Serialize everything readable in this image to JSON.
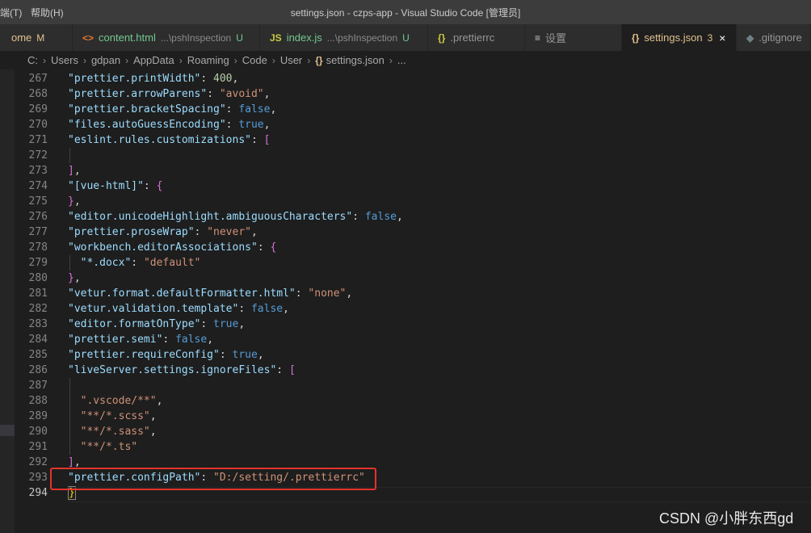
{
  "titlebar": {
    "menu_items": [
      "端(T)",
      "帮助(H)"
    ],
    "title": "settings.json - czps-app - Visual Studio Code [管理员]"
  },
  "tabs": [
    {
      "icon": "",
      "name": "ome",
      "desc": "",
      "status": "M",
      "active": false
    },
    {
      "icon": "<>",
      "name": "content.html",
      "desc": "...\\pshInspection",
      "status": "U",
      "active": false
    },
    {
      "icon": "JS",
      "name": "index.js",
      "desc": "...\\pshInspection",
      "status": "U",
      "active": false
    },
    {
      "icon": "{}",
      "name": ".prettierrc",
      "desc": "",
      "status": "",
      "active": false
    },
    {
      "icon": "≡",
      "name": "设置",
      "desc": "",
      "status": "",
      "active": false
    },
    {
      "icon": "{}",
      "name": "settings.json",
      "desc": "",
      "status": "3",
      "close": "×",
      "active": true
    },
    {
      "icon": "◆",
      "name": ".gitignore",
      "desc": "",
      "status": "",
      "active": false
    }
  ],
  "breadcrumb": {
    "items": [
      "C:",
      "Users",
      "gdpan",
      "AppData",
      "Roaming",
      "Code",
      "User",
      "settings.json",
      "..."
    ],
    "file_icon": "{}"
  },
  "editor": {
    "lines": [
      {
        "n": "267",
        "tokens": [
          [
            "k",
            "\"prettier.printWidth\""
          ],
          [
            "p",
            ": "
          ],
          [
            "n",
            "400"
          ],
          [
            "p",
            ","
          ]
        ]
      },
      {
        "n": "268",
        "tokens": [
          [
            "k",
            "\"prettier.arrowParens\""
          ],
          [
            "p",
            ": "
          ],
          [
            "s",
            "\"avoid\""
          ],
          [
            "p",
            ","
          ]
        ]
      },
      {
        "n": "269",
        "tokens": [
          [
            "k",
            "\"prettier.bracketSpacing\""
          ],
          [
            "p",
            ": "
          ],
          [
            "b",
            "false"
          ],
          [
            "p",
            ","
          ]
        ]
      },
      {
        "n": "270",
        "tokens": [
          [
            "k",
            "\"files.autoGuessEncoding\""
          ],
          [
            "p",
            ": "
          ],
          [
            "b",
            "true"
          ],
          [
            "p",
            ","
          ]
        ]
      },
      {
        "n": "271",
        "tokens": [
          [
            "k",
            "\"eslint.rules.customizations\""
          ],
          [
            "p",
            ": "
          ],
          [
            "m",
            "["
          ]
        ]
      },
      {
        "n": "272",
        "tokens": []
      },
      {
        "n": "273",
        "tokens": [
          [
            "m",
            "]"
          ],
          [
            "p",
            ","
          ]
        ]
      },
      {
        "n": "274",
        "tokens": [
          [
            "k",
            "\"[vue-html]\""
          ],
          [
            "p",
            ": "
          ],
          [
            "m",
            "{"
          ]
        ]
      },
      {
        "n": "275",
        "tokens": [
          [
            "m",
            "}"
          ],
          [
            "p",
            ","
          ]
        ]
      },
      {
        "n": "276",
        "tokens": [
          [
            "k",
            "\"editor.unicodeHighlight.ambiguousCharacters\""
          ],
          [
            "p",
            ": "
          ],
          [
            "b",
            "false"
          ],
          [
            "p",
            ","
          ]
        ]
      },
      {
        "n": "277",
        "tokens": [
          [
            "k",
            "\"prettier.proseWrap\""
          ],
          [
            "p",
            ": "
          ],
          [
            "s",
            "\"never\""
          ],
          [
            "p",
            ","
          ]
        ]
      },
      {
        "n": "278",
        "tokens": [
          [
            "k",
            "\"workbench.editorAssociations\""
          ],
          [
            "p",
            ": "
          ],
          [
            "m",
            "{"
          ]
        ]
      },
      {
        "n": "279",
        "tokens": [
          [
            "p",
            "  "
          ],
          [
            "k",
            "\"*.docx\""
          ],
          [
            "p",
            ": "
          ],
          [
            "s",
            "\"default\""
          ]
        ]
      },
      {
        "n": "280",
        "tokens": [
          [
            "m",
            "}"
          ],
          [
            "p",
            ","
          ]
        ]
      },
      {
        "n": "281",
        "tokens": [
          [
            "k",
            "\"vetur.format.defaultFormatter.html\""
          ],
          [
            "p",
            ": "
          ],
          [
            "s",
            "\"none\""
          ],
          [
            "p",
            ","
          ]
        ]
      },
      {
        "n": "282",
        "tokens": [
          [
            "k",
            "\"vetur.validation.template\""
          ],
          [
            "p",
            ": "
          ],
          [
            "b",
            "false"
          ],
          [
            "p",
            ","
          ]
        ]
      },
      {
        "n": "283",
        "tokens": [
          [
            "k",
            "\"editor.formatOnType\""
          ],
          [
            "p",
            ": "
          ],
          [
            "b",
            "true"
          ],
          [
            "p",
            ","
          ]
        ]
      },
      {
        "n": "284",
        "tokens": [
          [
            "k",
            "\"prettier.semi\""
          ],
          [
            "p",
            ": "
          ],
          [
            "b",
            "false"
          ],
          [
            "p",
            ","
          ]
        ]
      },
      {
        "n": "285",
        "tokens": [
          [
            "k",
            "\"prettier.requireConfig\""
          ],
          [
            "p",
            ": "
          ],
          [
            "b",
            "true"
          ],
          [
            "p",
            ","
          ]
        ]
      },
      {
        "n": "286",
        "tokens": [
          [
            "k",
            "\"liveServer.settings.ignoreFiles\""
          ],
          [
            "p",
            ": "
          ],
          [
            "m",
            "["
          ]
        ]
      },
      {
        "n": "287",
        "tokens": []
      },
      {
        "n": "288",
        "tokens": [
          [
            "p",
            "  "
          ],
          [
            "s",
            "\".vscode/**\""
          ],
          [
            "p",
            ","
          ]
        ]
      },
      {
        "n": "289",
        "tokens": [
          [
            "p",
            "  "
          ],
          [
            "s",
            "\"**/*.scss\""
          ],
          [
            "p",
            ","
          ]
        ]
      },
      {
        "n": "290",
        "tokens": [
          [
            "p",
            "  "
          ],
          [
            "s",
            "\"**/*.sass\""
          ],
          [
            "p",
            ","
          ]
        ]
      },
      {
        "n": "291",
        "tokens": [
          [
            "p",
            "  "
          ],
          [
            "s",
            "\"**/*.ts\""
          ]
        ]
      },
      {
        "n": "292",
        "tokens": [
          [
            "m",
            "]"
          ],
          [
            "p",
            ","
          ]
        ]
      },
      {
        "n": "293",
        "tokens": [
          [
            "k",
            "\"prettier.configPath\""
          ],
          [
            "p",
            ": "
          ],
          [
            "s",
            "\"D:/setting/.prettierrc\""
          ]
        ]
      },
      {
        "n": "294",
        "tokens": [
          [
            "y",
            "}"
          ]
        ]
      }
    ]
  },
  "watermark": "CSDN @小胖东西gd",
  "colors": {
    "accent_active_tab_text": "#e2c08d",
    "highlight_box": "#e5332a"
  }
}
